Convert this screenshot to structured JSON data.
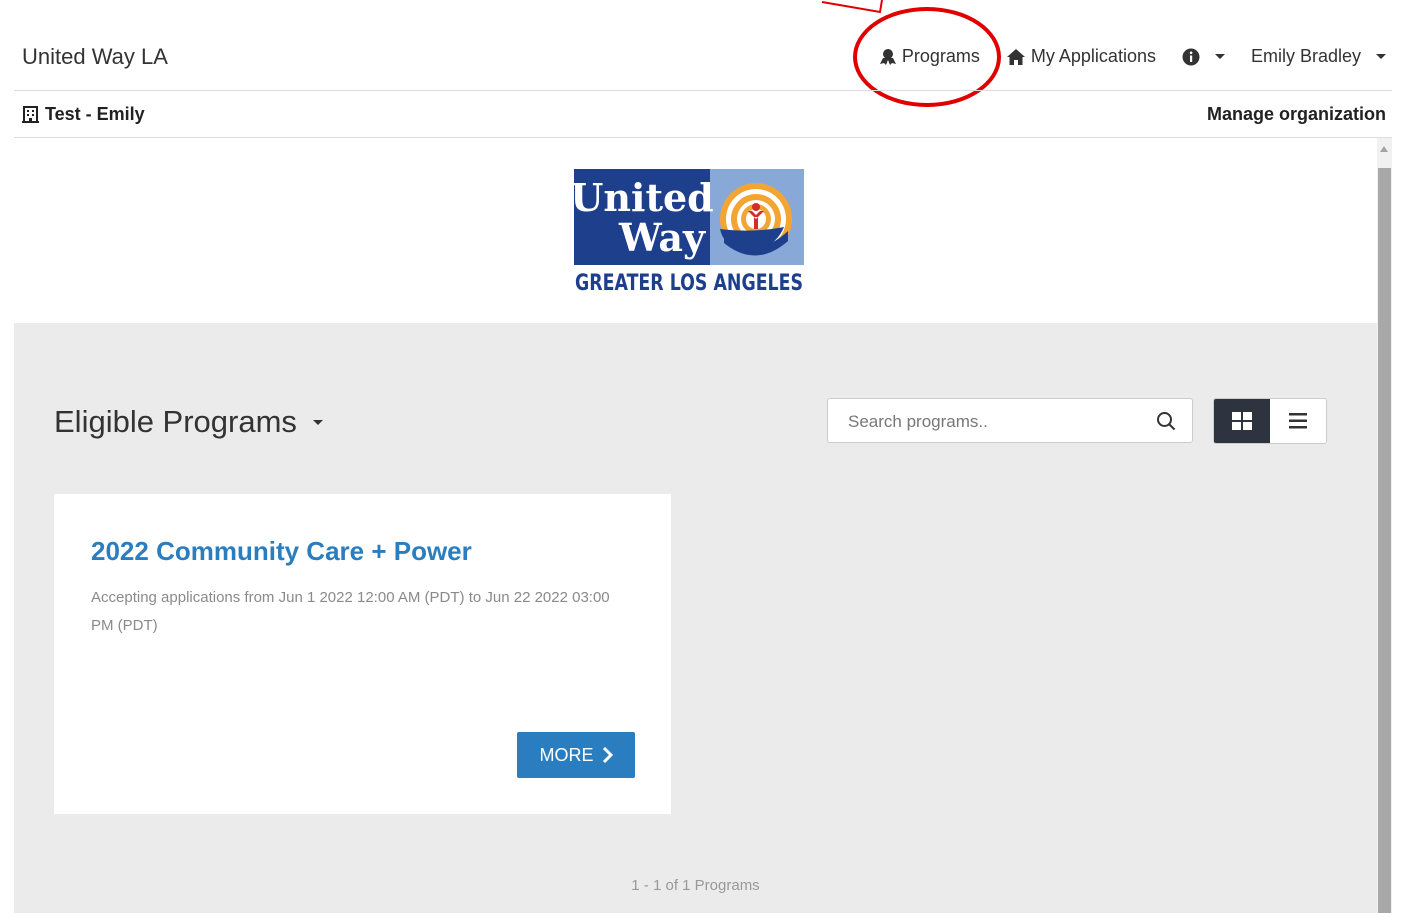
{
  "navbar": {
    "brand": "United Way LA",
    "programs_label": "Programs",
    "my_applications_label": "My Applications",
    "user_name": "Emily Bradley"
  },
  "org_bar": {
    "org_name": "Test - Emily",
    "manage_label": "Manage organization"
  },
  "logo": {
    "line1": "United",
    "line2": "Way",
    "subtitle": "GREATER LOS ANGELES",
    "colors": {
      "navy": "#1e3f8b",
      "light_blue": "#88a8d8",
      "orange": "#f2a533",
      "red": "#d62b2b"
    }
  },
  "main": {
    "title": "Eligible Programs",
    "search_placeholder": "Search programs..",
    "pagination": "1 - 1 of 1 Programs"
  },
  "programs": [
    {
      "title": "2022 Community Care + Power",
      "description": "Accepting applications from Jun 1 2022 12:00 AM (PDT) to Jun 22 2022 03:00 PM (PDT)",
      "button_label": "MORE"
    }
  ],
  "colors": {
    "accent": "#2a7ec0",
    "annotation": "#e00000",
    "active_toggle": "#2d3440",
    "content_bg": "#ebebeb"
  }
}
